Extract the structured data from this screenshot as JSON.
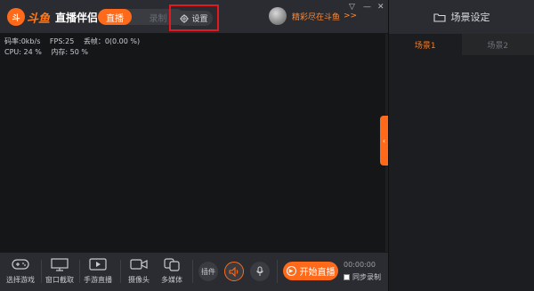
{
  "app": {
    "logo_mark": "斗",
    "brand": "斗鱼",
    "name": "直播伴侣"
  },
  "mode_toggle": {
    "live_label": "直播",
    "record_label": "录制"
  },
  "settings": {
    "label": "设置"
  },
  "user": {
    "name": "精彩尽在斗鱼",
    "more": ">>"
  },
  "window": {
    "dropdown": "▽",
    "minimize": "—",
    "close": "✕"
  },
  "stats": {
    "bitrate": "码率:0kb/s",
    "fps": "FPS:25",
    "dropped": "丢帧：0(0.00 %)",
    "cpu": "CPU: 24 %",
    "memory": "内存: 50 %"
  },
  "collapse": {
    "glyph": "‹"
  },
  "toolbar": {
    "tools": [
      {
        "label": "选择游戏",
        "icon": "gamepad-icon"
      },
      {
        "label": "窗口截取",
        "icon": "monitor-icon"
      },
      {
        "label": "手游直播",
        "icon": "mobile-screen-icon"
      },
      {
        "label": "摄像头",
        "icon": "camera-icon"
      },
      {
        "label": "多媒体",
        "icon": "media-icon"
      }
    ],
    "plugin_label": "插件",
    "start_label": "开始直播",
    "timer": "00:00:00",
    "sync_record_label": "同步录制"
  },
  "right_panel": {
    "title": "场景设定",
    "tabs": [
      {
        "label": "场景1",
        "active": true
      },
      {
        "label": "场景2",
        "active": false
      }
    ]
  },
  "colors": {
    "accent": "#ff6a1a",
    "highlight_box": "#e4191f",
    "bg_dark": "#151618",
    "bar": "#2a2c31"
  }
}
